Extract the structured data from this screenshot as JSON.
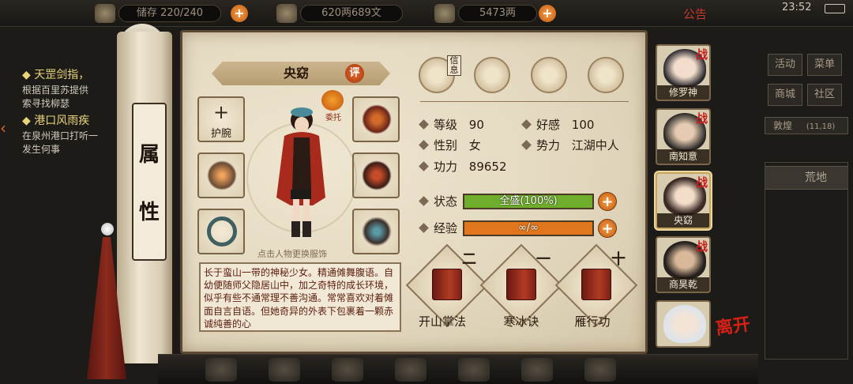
{
  "topbar": {
    "capacity_label": "储存",
    "capacity_value": "220/240",
    "money": "620两689文",
    "gold": "5473两",
    "notice": "公告",
    "clock": "23:52"
  },
  "quests": [
    {
      "title": "天罡剑指，",
      "lines": [
        "根据百里苏提供",
        "索寻找柳瑟"
      ]
    },
    {
      "title": "港口风雨疾",
      "lines": [
        "在泉州港口打听一",
        "发生何事"
      ]
    }
  ],
  "right_menu": {
    "activity": "活动",
    "menu": "菜单",
    "clan": "商城",
    "community": "社区",
    "location": "敦煌",
    "coords": "(11,18)",
    "area": "荒地"
  },
  "scroll": {
    "label_top": "属",
    "label_bottom": "性"
  },
  "character": {
    "name": "央窈",
    "rate_badge": "评",
    "delegate_label": "委托",
    "portrait_hint": "点击人物更换服饰",
    "description": "长于蛮山一带的神秘少女。精通傩舞腹语。自幼便随师父隐居山中，加之奇特的成长环境，似乎有些不通常理不善沟通。常常喜欢对着傩面自言自语。但她奇异的外表下包裹着一颗赤诚纯善的心"
  },
  "equipment": {
    "left": [
      {
        "name": "bracer",
        "empty": true,
        "label": "护腕"
      },
      {
        "name": "claw-weapon",
        "empty": false
      },
      {
        "name": "bangle",
        "empty": false
      }
    ],
    "right": [
      {
        "name": "armor-top",
        "empty": false
      },
      {
        "name": "armor-body",
        "empty": false
      },
      {
        "name": "charm",
        "empty": false
      }
    ]
  },
  "tabs": {
    "info_label": "信息"
  },
  "stats": {
    "level_label": "等级",
    "level": "90",
    "favor_label": "好感",
    "favor": "100",
    "gender_label": "性别",
    "gender": "女",
    "faction_label": "势力",
    "faction": "江湖中人",
    "power_label": "功力",
    "power": "89652",
    "state_label": "状态",
    "state_text": "全盛(100%)",
    "state_fill": 1.0,
    "exp_label": "经验",
    "exp_text": "∞/∞",
    "exp_fill": 1.0
  },
  "skills": [
    {
      "name": "开山掌法",
      "rank": "二"
    },
    {
      "name": "寒冰诀",
      "rank": "一"
    },
    {
      "name": "雁行功",
      "rank": "十"
    }
  ],
  "party": [
    {
      "name": "修罗神",
      "war": "战",
      "active": false
    },
    {
      "name": "南知意",
      "war": "战",
      "active": false
    },
    {
      "name": "央窈",
      "war": "战",
      "active": true
    },
    {
      "name": "商昊乾",
      "war": "战",
      "active": false
    },
    {
      "name": "",
      "war": "",
      "active": false
    }
  ],
  "leave_label": "离开",
  "colors": {
    "state_bar": "#6fae2d",
    "exp_bar": "#e0761d",
    "accent_red": "#c81e1e"
  }
}
